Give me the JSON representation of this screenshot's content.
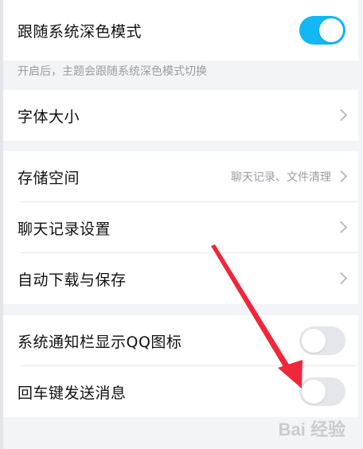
{
  "dark_mode": {
    "label": "跟随系统深色模式",
    "toggle_on": true,
    "hint": "开启后，主题会跟随系统深色模式切换"
  },
  "font_size": {
    "label": "字体大小"
  },
  "storage": {
    "label": "存储空间",
    "value": "聊天记录、文件清理"
  },
  "chat_history": {
    "label": "聊天记录设置"
  },
  "auto_download": {
    "label": "自动下载与保存"
  },
  "notify_icon": {
    "label": "系统通知栏显示QQ图标",
    "toggle_on": false
  },
  "enter_send": {
    "label": "回车键发送消息",
    "toggle_on": false
  },
  "colors": {
    "accent": "#12b7f5",
    "annotation_arrow": "#f0263a"
  },
  "watermark": {
    "text": "Bai 经验"
  }
}
